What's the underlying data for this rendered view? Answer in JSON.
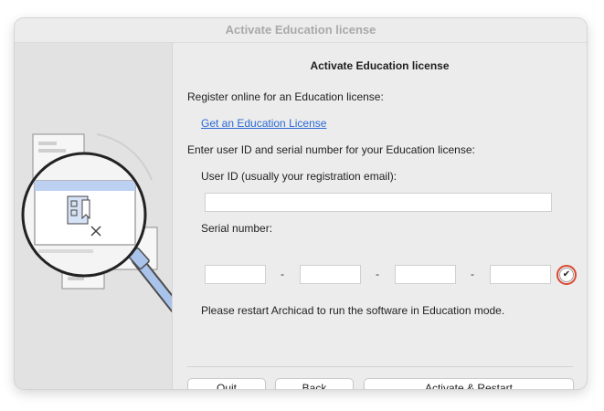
{
  "window": {
    "title": "Activate Education license"
  },
  "content": {
    "heading": "Activate Education license",
    "register_text": "Register online for an Education license:",
    "link_text": "Get an Education License",
    "enter_text": "Enter user ID and serial number for your Education license:",
    "user_id_label": "User ID (usually your registration email):",
    "user_id_value": "",
    "serial_label": "Serial number:",
    "serial_separator": "-",
    "serial_parts": [
      "",
      "",
      "",
      ""
    ],
    "restart_note": "Please restart Archicad to run the software in Education mode."
  },
  "buttons": {
    "quit": "Quit",
    "back": "Back",
    "activate": "Activate & Restart"
  },
  "icons": {
    "illustration": "magnifier-document-icon",
    "verify": "checkmark-icon"
  },
  "colors": {
    "link": "#2a6ad4",
    "verify_ring": "#d9472f",
    "magnifier_handle": "#a9c3ea"
  }
}
